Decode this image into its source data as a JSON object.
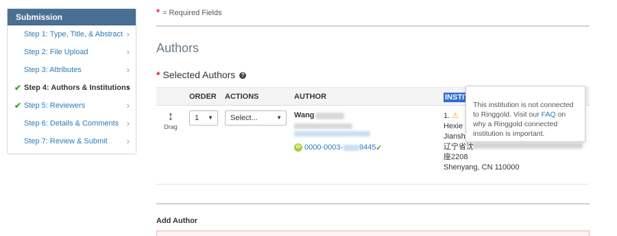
{
  "sidebar": {
    "header": "Submission",
    "items": [
      {
        "label": "Step 1: Type, Title, & Abstract",
        "completed": false,
        "active": false
      },
      {
        "label": "Step 2: File Upload",
        "completed": false,
        "active": false
      },
      {
        "label": "Step 3: Attributes",
        "completed": false,
        "active": false
      },
      {
        "label": "Step 4: Authors & Institutions",
        "completed": true,
        "active": true
      },
      {
        "label": "Step 5: Reviewers",
        "completed": true,
        "active": false
      },
      {
        "label": "Step 6: Details & Comments",
        "completed": false,
        "active": false
      },
      {
        "label": "Step 7: Review & Submit",
        "completed": false,
        "active": false
      }
    ]
  },
  "main": {
    "required_note": "= Required Fields",
    "required_star": "*",
    "section_title": "Authors",
    "selected_authors_title": "Selected Authors",
    "help_glyph": "?",
    "table": {
      "headers": {
        "order": "ORDER",
        "actions": "ACTIONS",
        "author": "AUTHOR",
        "institution": "INSTITU"
      },
      "row": {
        "drag_label": "Drag",
        "drag_glyph": "↕",
        "order_value": "1",
        "actions_value": "Select...",
        "author_name": "Wang",
        "orcid_prefix": "0000-0003-",
        "orcid_suffix": "9445",
        "orcid_check": "✓",
        "institution": {
          "line1_prefix": "1.",
          "warn_glyph": "⚠",
          "line2": "Hexie E",
          "line3": "Jianshe",
          "line4": "辽宁省沈",
          "line5": "座2208",
          "line6": "Shenyang, CN 110000"
        }
      }
    },
    "tooltip": {
      "text_before": "This institution is not connected to Ringgold. Visit our",
      "link": "FAQ",
      "text_after": "on why a Ringgold connected institution is important."
    },
    "add_author_title": "Add Author"
  },
  "colors": {
    "sidebar_header_bg": "#4a6f94",
    "link_blue": "#2a7ab8",
    "required_red": "#d9232e",
    "check_green": "#3aa52a",
    "orcid_green": "#a6ce39",
    "warning_orange": "#f0a000"
  },
  "icons": {
    "check": "check-icon",
    "chevron": "chevron-right-icon",
    "drag": "drag-handle-icon",
    "help": "help-circle-icon",
    "orcid": "orcid-icon",
    "warning": "warning-icon"
  }
}
